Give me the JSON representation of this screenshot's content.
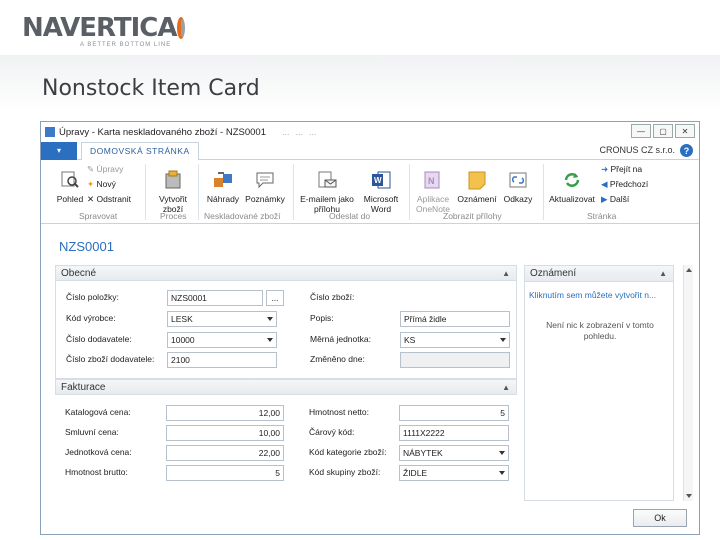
{
  "slide": {
    "logo_text": "NAVERTICA",
    "logo_tagline": "A BETTER BOTTOM LINE",
    "title": "Nonstock Item Card"
  },
  "window": {
    "title": "Úpravy - Karta neskladovaného zboží - NZS0001",
    "breadcrumbs": [
      "...",
      "...",
      "..."
    ],
    "company": "CRONUS CZ s.r.o.",
    "file_tab": "▾",
    "home_tab": "DOMOVSKÁ STRÁNKA"
  },
  "ribbon": {
    "manage": {
      "label": "Spravovat",
      "view": "Pohled",
      "edit": "Úpravy",
      "new": "Nový",
      "delete": "Odstranit"
    },
    "process": {
      "label": "Proces",
      "create": "Vytvořit zboží"
    },
    "nonstock": {
      "label": "Neskladované zboží",
      "substitutions": "Náhrady",
      "comments": "Poznámky"
    },
    "send": {
      "label": "Odeslat do",
      "email": "E-mailem jako přílohu",
      "word": "Microsoft Word"
    },
    "attachments": {
      "label": "Zobrazit přílohy",
      "onenote": "Aplikace OneNote",
      "notes": "Oznámení",
      "links": "Odkazy"
    },
    "page": {
      "label": "Stránka",
      "refresh": "Aktualizovat",
      "goto": "Přejít na",
      "previous": "Předchozí",
      "next": "Další"
    }
  },
  "record": {
    "number": "NZS0001"
  },
  "general": {
    "header": "Obecné",
    "item_no_label": "Číslo položky:",
    "item_no_value": "NZS0001",
    "manufacturer_label": "Kód výrobce:",
    "manufacturer_value": "LESK",
    "vendor_label": "Číslo dodavatele:",
    "vendor_value": "10000",
    "vendor_item_label": "Číslo zboží dodavatele:",
    "vendor_item_value": "2100",
    "goods_no_label": "Číslo zboží:",
    "goods_no_value": "",
    "description_label": "Popis:",
    "description_value": "Přímá židle",
    "uom_label": "Měrná jednotka:",
    "uom_value": "KS",
    "modified_label": "Změněno dne:",
    "modified_value": ""
  },
  "invoicing": {
    "header": "Fakturace",
    "catalog_price_label": "Katalogová cena:",
    "catalog_price_value": "12,00",
    "contract_price_label": "Smluvní cena:",
    "contract_price_value": "10,00",
    "unit_price_label": "Jednotková cena:",
    "unit_price_value": "22,00",
    "gross_weight_label": "Hmotnost brutto:",
    "gross_weight_value": "5",
    "net_weight_label": "Hmotnost netto:",
    "net_weight_value": "5",
    "barcode_label": "Čárový kód:",
    "barcode_value": "1111X2222",
    "category_label": "Kód kategorie zboží:",
    "category_value": "NÁBYTEK",
    "group_label": "Kód skupiny zboží:",
    "group_value": "ŽIDLE"
  },
  "notifications": {
    "header": "Oznámení",
    "link": "Kliknutím sem můžete vytvořit n...",
    "message": "Není nic k zobrazení v tomto pohledu."
  },
  "ok_label": "Ok",
  "colors": {
    "accent": "#2a6fc0",
    "logo_orange": "#e36c1d"
  }
}
